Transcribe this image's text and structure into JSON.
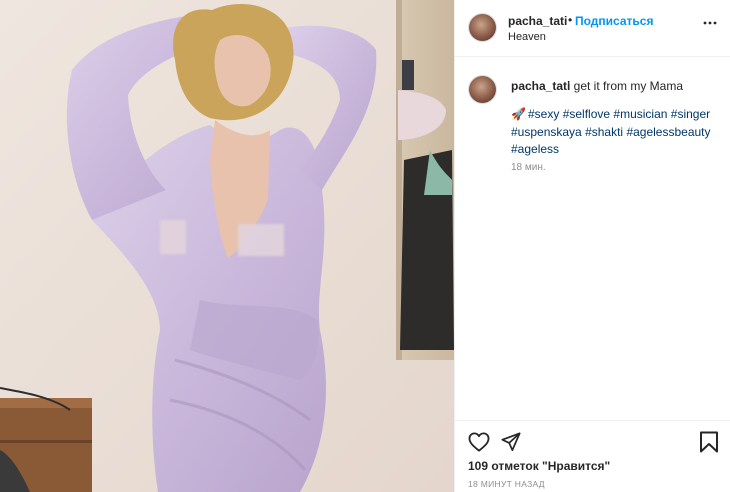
{
  "post": {
    "author": "pacha_tati",
    "separator": "•",
    "follow_label": "Подписаться",
    "location": "Heaven",
    "caption": {
      "username": "pacha_tati",
      "text": "I get it from my Mama",
      "rocket": "🚀",
      "hashtags": [
        "#sexy",
        "#selflove",
        "#musician",
        "#singer",
        "#uspenskaya",
        "#shakti",
        "#agelessbeauty",
        "#ageless"
      ],
      "time": "18 мин."
    },
    "likes": "109 отметок \"Нравится\"",
    "time_ago": "18 МИНУТ НАЗАД"
  },
  "icons": {
    "more": "more-icon",
    "like": "heart-icon",
    "share": "share-icon",
    "save": "bookmark-icon"
  },
  "colors": {
    "link": "#00376b",
    "follow": "#0095f6",
    "muted": "#8e8e8e",
    "text": "#262626"
  }
}
